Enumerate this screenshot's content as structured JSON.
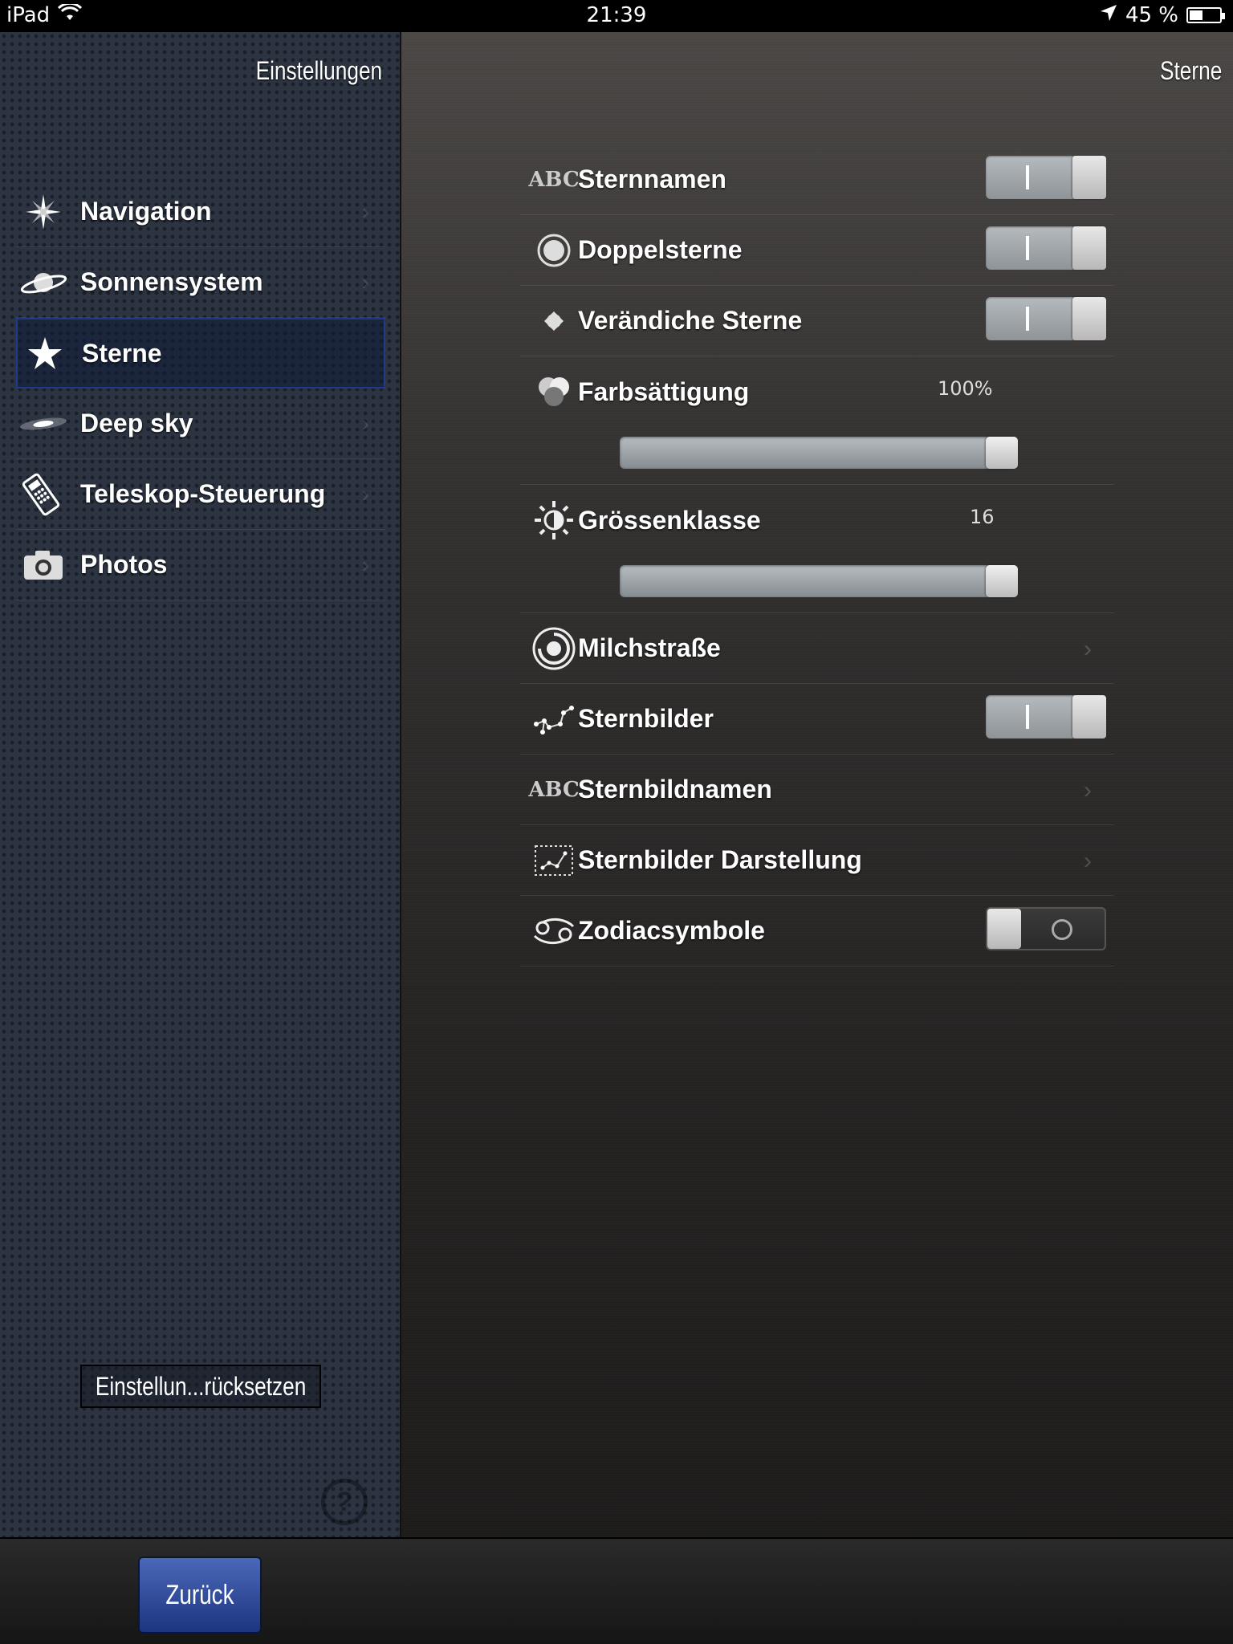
{
  "status": {
    "device": "iPad",
    "time": "21:39",
    "battery": "45 %",
    "battery_level": 0.45
  },
  "sidebar": {
    "title": "Einstellungen",
    "items": [
      {
        "label": "Navigation",
        "icon": "compass-star-icon"
      },
      {
        "label": "Sonnensystem",
        "icon": "saturn-icon"
      },
      {
        "label": "Sterne",
        "icon": "star-icon",
        "selected": true
      },
      {
        "label": "Deep sky",
        "icon": "galaxy-icon"
      },
      {
        "label": "Teleskop-Steuerung",
        "icon": "remote-control-icon"
      },
      {
        "label": "Photos",
        "icon": "camera-icon"
      }
    ],
    "reset_label": "Einstellun...rücksetzen",
    "help_label": "?"
  },
  "detail": {
    "title": "Sterne",
    "rows": [
      {
        "label": "Sternnamen",
        "icon": "abc-icon",
        "control": "toggle",
        "on": true
      },
      {
        "label": "Doppelsterne",
        "icon": "double-star-icon",
        "control": "toggle",
        "on": true
      },
      {
        "label": "Verändiche Sterne",
        "icon": "variable-star-icon",
        "control": "toggle",
        "on": true
      },
      {
        "label": "Farbsättigung",
        "icon": "color-circles-icon",
        "control": "slider",
        "value": "100%",
        "level": 1.0
      },
      {
        "label": "Grössenklasse",
        "icon": "brightness-icon",
        "control": "slider",
        "value": "16",
        "level": 1.0
      },
      {
        "label": "Milchstraße",
        "icon": "milky-way-icon",
        "control": "disclosure"
      },
      {
        "label": "Sternbilder",
        "icon": "constellation-icon",
        "control": "toggle",
        "on": true
      },
      {
        "label": "Sternbildnamen",
        "icon": "abc-icon",
        "control": "disclosure"
      },
      {
        "label": "Sternbilder Darstellung",
        "icon": "constellation-frame-icon",
        "control": "disclosure"
      },
      {
        "label": "Zodiacsymbole",
        "icon": "zodiac-cancer-icon",
        "control": "toggle",
        "on": false
      }
    ],
    "abc_text": "ABC"
  },
  "bottombar": {
    "back_label": "Zurück"
  }
}
